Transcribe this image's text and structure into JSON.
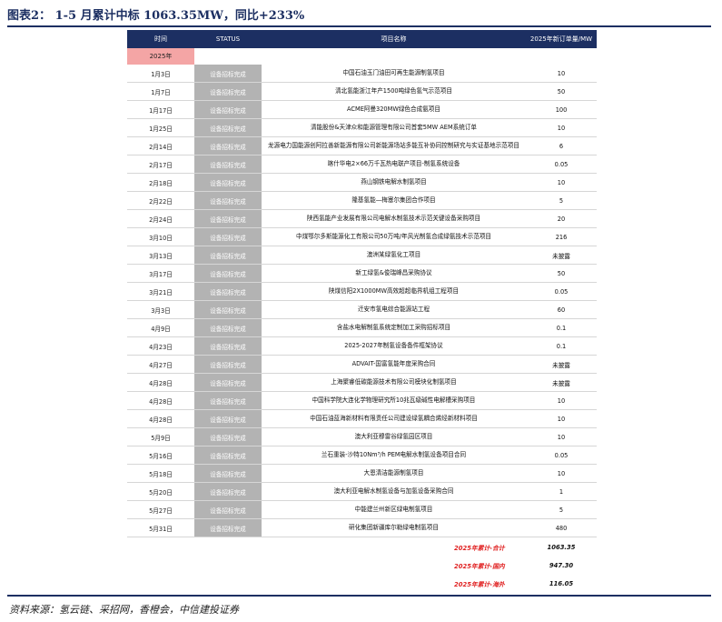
{
  "title": "图表2：  1-5 月累计中标 1063.35MW，同比+233%",
  "columns": {
    "time": "时间",
    "status": "STATUS",
    "name": "项目名称",
    "cap": "2025年新订单量/MW"
  },
  "year_label": "2025年",
  "rows": [
    {
      "time": "1月3日",
      "status": "设备招标完成",
      "name": "中国石油玉门油田可再生能源制氢项目",
      "cap": "10"
    },
    {
      "time": "1月7日",
      "status": "设备招标完成",
      "name": "清北氢能浙江年产1500吨绿色氢气示范项目",
      "cap": "50"
    },
    {
      "time": "1月17日",
      "status": "设备招标完成",
      "name": "ACME阿曼320MW绿色合成氨项目",
      "cap": "100"
    },
    {
      "time": "1月25日",
      "status": "设备招标完成",
      "name": "清能股份&天津众和能源管理有限公司首套5MW AEM系统订单",
      "cap": "10"
    },
    {
      "time": "2月14日",
      "status": "设备招标完成",
      "name": "龙源电力国能源创阿拉善新能源有限公司新能源场站多能互补协同控制研究与实证基地示范项目",
      "cap": "6"
    },
    {
      "time": "2月17日",
      "status": "设备招标完成",
      "name": "喀什华电2×66万千瓦热电联产项目-制氢系统设备",
      "cap": "0.05"
    },
    {
      "time": "2月18日",
      "status": "设备招标完成",
      "name": "燕山钢铁电解水制氢项目",
      "cap": "10"
    },
    {
      "time": "2月22日",
      "status": "设备招标完成",
      "name": "隆基氢能—梅塞尔集团合作项目",
      "cap": "5"
    },
    {
      "time": "2月24日",
      "status": "设备招标完成",
      "name": "陕西氢能产业发展有限公司电解水制氢技术示范关键设备采购项目",
      "cap": "20"
    },
    {
      "time": "3月10日",
      "status": "设备招标完成",
      "name": "中煤鄂尔多斯能源化工有限公司50万吨/年风光制氢合成绿氨技术示范项目",
      "cap": "216"
    },
    {
      "time": "3月13日",
      "status": "设备招标完成",
      "name": "澳洲某绿氢化工项目",
      "cap": "未披露"
    },
    {
      "time": "3月17日",
      "status": "设备招标完成",
      "name": "新工绿氢&俊瑞峰昌采购协议",
      "cap": "50"
    },
    {
      "time": "3月21日",
      "status": "设备招标完成",
      "name": "陕煤信阳2X1000MW高效超超临界机组工程项目",
      "cap": "0.05"
    },
    {
      "time": "3月3日",
      "status": "设备招标完成",
      "name": "迁安市氢电综合能源站工程",
      "cap": "60"
    },
    {
      "time": "4月9日",
      "status": "设备招标完成",
      "name": "含盐水电解制氢系统定制加工采购招标项目",
      "cap": "0.1"
    },
    {
      "time": "4月23日",
      "status": "设备招标完成",
      "name": "2025-2027年制氢设备备件框架协议",
      "cap": "0.1"
    },
    {
      "time": "4月27日",
      "status": "设备招标完成",
      "name": "ADVAIT-国富氢能年度采购合同",
      "cap": "未披露"
    },
    {
      "time": "4月28日",
      "status": "设备招标完成",
      "name": "上海聚睿低碳能源技术有限公司模块化制氢项目",
      "cap": "未披露"
    },
    {
      "time": "4月28日",
      "status": "设备招标完成",
      "name": "中国科学院大连化学物理研究所10兆瓦级碱性电解槽采购项目",
      "cap": "10"
    },
    {
      "time": "4月28日",
      "status": "设备招标完成",
      "name": "中国石油蓝海新材料有限责任公司建设绿氢耦合烯烃新材料项目",
      "cap": "10"
    },
    {
      "time": "5月9日",
      "status": "设备招标完成",
      "name": "澳大利亚穆雷谷绿氢园区项目",
      "cap": "10"
    },
    {
      "time": "5月16日",
      "status": "设备招标完成",
      "name": "兰石重装-沙特10Nm³/h PEM电解水制氢设备项目合同",
      "cap": "0.05"
    },
    {
      "time": "5月18日",
      "status": "设备招标完成",
      "name": "大恩清洁能源制氢项目",
      "cap": "10"
    },
    {
      "time": "5月20日",
      "status": "设备招标完成",
      "name": "澳大利亚电解水制氢设备与加氢设备采购合同",
      "cap": "1"
    },
    {
      "time": "5月27日",
      "status": "设备招标完成",
      "name": "中能建兰州新区绿电制氢项目",
      "cap": "5"
    },
    {
      "time": "5月31日",
      "status": "设备招标完成",
      "name": "研化集团新疆库尔勒绿电制氢项目",
      "cap": "480"
    }
  ],
  "summary": [
    {
      "label": "2025年累计-合计",
      "value": "1063.35"
    },
    {
      "label": "2025年累计-国内",
      "value": "947.30"
    },
    {
      "label": "2025年累计-海外",
      "value": "116.05"
    }
  ],
  "source": "资料来源：氢云链、采招网，香橙会，中信建投证券",
  "colors": {
    "header_bg": "#1c2f62",
    "year_bg": "#f4a5a5",
    "status_bg": "#b3b3b3",
    "summary_label": "#e02020"
  }
}
